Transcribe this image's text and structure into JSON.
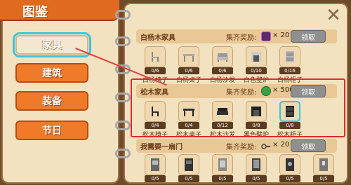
{
  "header": {
    "title": "图鉴"
  },
  "tabs": [
    {
      "label": "家具",
      "selected": true
    },
    {
      "label": "建筑",
      "selected": false
    },
    {
      "label": "装备",
      "selected": false
    },
    {
      "label": "节日",
      "selected": false
    }
  ],
  "close_icon": "close-icon",
  "sections": [
    {
      "title": "白杨木家具",
      "reward_label": "集齐奖励:",
      "reward_icon": "purple-box-icon",
      "reward_count": "× 20",
      "claim_label": "领取",
      "items": [
        {
          "count": "0/6",
          "name": "白杨椅子"
        },
        {
          "count": "0/6",
          "name": "白杨桌子"
        },
        {
          "count": "0/6",
          "name": "白杨沙发"
        },
        {
          "count": "0/10",
          "name": "白色壁炉"
        },
        {
          "count": "0/16",
          "name": "白杨柜子"
        }
      ]
    },
    {
      "title": "松木家具",
      "reward_label": "集齐奖励:",
      "reward_icon": "green-gem-icon",
      "reward_count": "× 500",
      "claim_label": "领取",
      "items": [
        {
          "count": "0/4",
          "name": "松木椅子"
        },
        {
          "count": "0/4",
          "name": "松木桌子"
        },
        {
          "count": "0/12",
          "name": "松木沙发"
        },
        {
          "count": "0/8",
          "name": "黑色壁炉"
        },
        {
          "count": "0/8",
          "name": "松木柜子"
        }
      ]
    },
    {
      "title": "我需要一扇门",
      "reward_label": "集齐奖励:",
      "reward_icon": "key-icon",
      "reward_count": "× 20",
      "claim_label": "领取",
      "items": [
        {
          "count": "0/5",
          "name": ""
        },
        {
          "count": "0/5",
          "name": ""
        },
        {
          "count": "0/5",
          "name": ""
        },
        {
          "count": "0/5",
          "name": ""
        },
        {
          "count": "0/5",
          "name": ""
        },
        {
          "count": "0/5",
          "name": ""
        }
      ]
    }
  ],
  "colors": {
    "accent": "#ee7a2a",
    "highlight": "#e02a2a",
    "selection": "#38c7e0"
  }
}
